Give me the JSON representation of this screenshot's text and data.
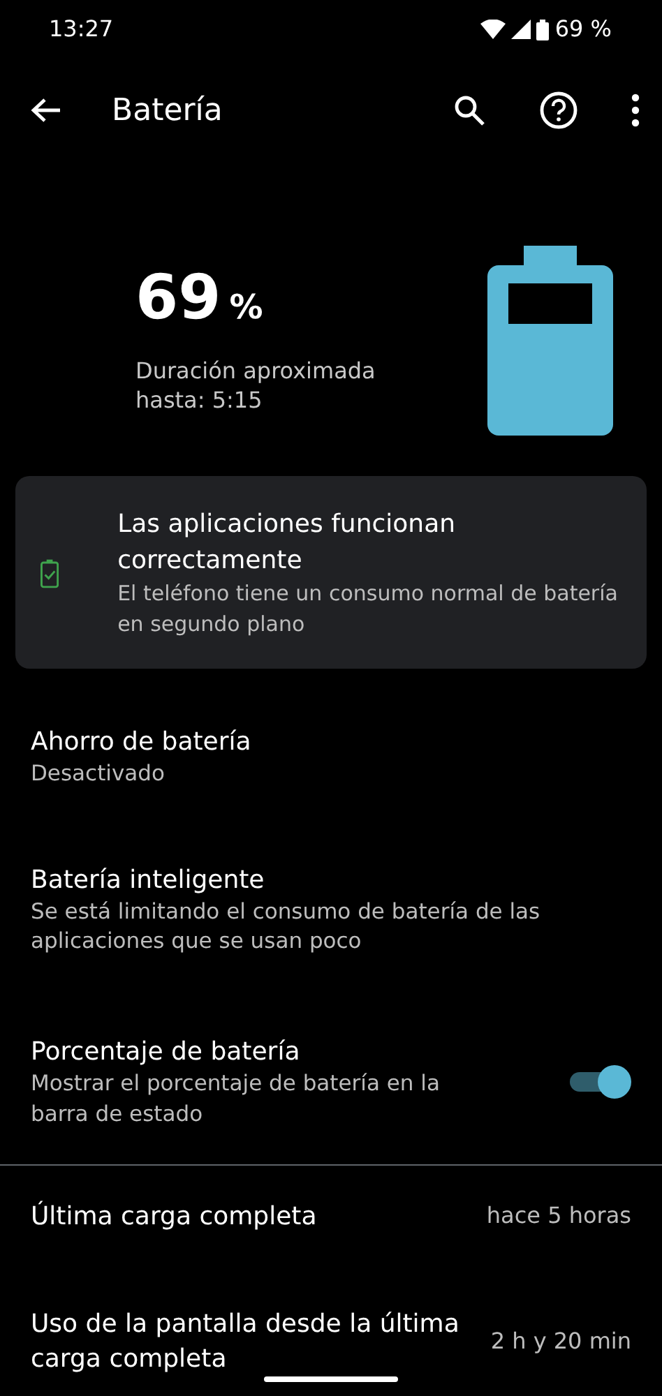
{
  "status_bar": {
    "time": "13:27",
    "battery": "69 %"
  },
  "app_bar": {
    "title": "Batería"
  },
  "summary": {
    "percent": "69",
    "unit": "%",
    "estimate": "Duración aproximada hasta: 5:15"
  },
  "tip_card": {
    "title": "Las aplicaciones funcionan correctamente",
    "text": "El teléfono tiene un consumo normal de batería en segundo plano"
  },
  "settings": [
    {
      "kind": "text",
      "title": "Ahorro de batería",
      "summary": "Desactivado"
    },
    {
      "kind": "text",
      "title": "Batería inteligente",
      "summary": "Se está limitando el consumo de batería de las aplicaciones que se usan poco"
    },
    {
      "kind": "switch",
      "title": "Porcentaje de batería",
      "summary": "Mostrar el porcentaje de batería en la barra de estado",
      "on": true
    }
  ],
  "stats": [
    {
      "label": "Última carga completa",
      "value": "hace 5 horas"
    },
    {
      "label": "Uso de la pantalla desde la última carga completa",
      "value": "2 h y 20 min"
    }
  ]
}
